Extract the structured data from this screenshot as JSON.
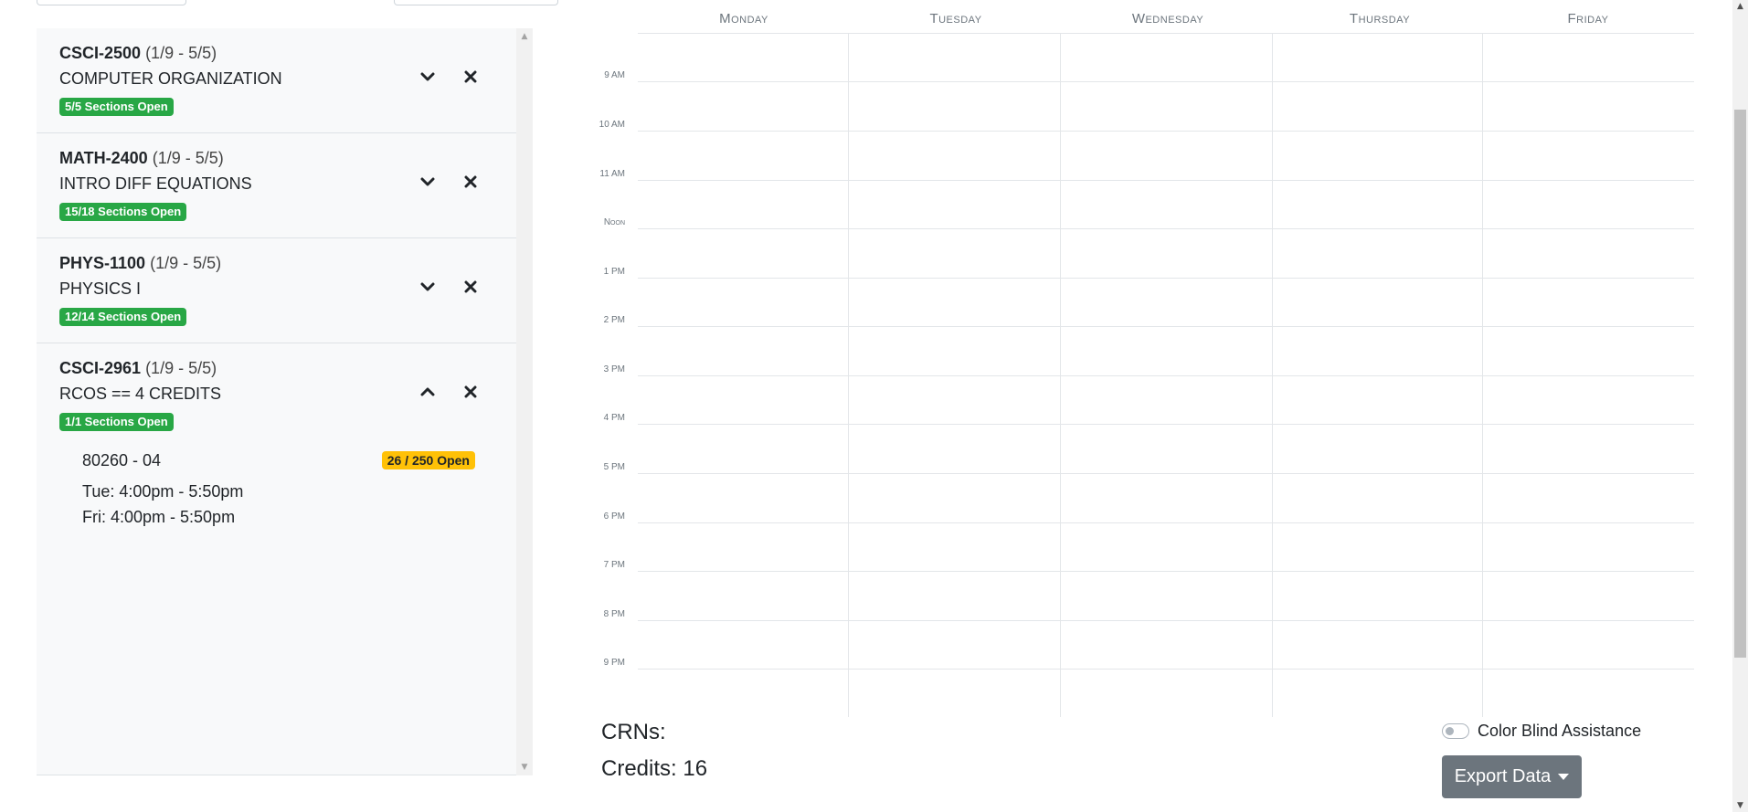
{
  "courses": [
    {
      "code": "CSCI-2500",
      "dates": "(1/9 - 5/5)",
      "title": "COMPUTER ORGANIZATION",
      "open": "5/5 Sections Open"
    },
    {
      "code": "MATH-2400",
      "dates": "(1/9 - 5/5)",
      "title": "INTRO DIFF EQUATIONS",
      "open": "15/18 Sections Open"
    },
    {
      "code": "PHYS-1100",
      "dates": "(1/9 - 5/5)",
      "title": "PHYSICS I",
      "open": "12/14 Sections Open"
    },
    {
      "code": "CSCI-2961",
      "dates": "(1/9 - 5/5)",
      "title": "RCOS == 4 CREDITS",
      "open": "1/1 Sections Open",
      "section": {
        "id": "80260 - 04",
        "seats": "26 / 250 Open",
        "meetings": [
          "Tue: 4:00pm - 5:50pm",
          "Fri: 4:00pm - 5:50pm"
        ]
      }
    }
  ],
  "calendar": {
    "days": [
      "Monday",
      "Tuesday",
      "Wednesday",
      "Thursday",
      "Friday"
    ],
    "times": [
      "9 AM",
      "10 AM",
      "11 AM",
      "Noon",
      "1 PM",
      "2 PM",
      "3 PM",
      "4 PM",
      "5 PM",
      "6 PM",
      "7 PM",
      "8 PM",
      "9 PM"
    ]
  },
  "footer": {
    "crns_label": "CRNs:",
    "credits_label": "Credits: 16",
    "color_blind_label": "Color Blind Assistance",
    "export_label": "Export Data"
  },
  "colors": {
    "open_badge": "#28a745",
    "seat_badge": "#ffc107",
    "export_button": "#6c757d"
  },
  "icons": {
    "expand": "chevron-down-icon",
    "collapse": "chevron-up-icon",
    "remove": "close-icon"
  }
}
